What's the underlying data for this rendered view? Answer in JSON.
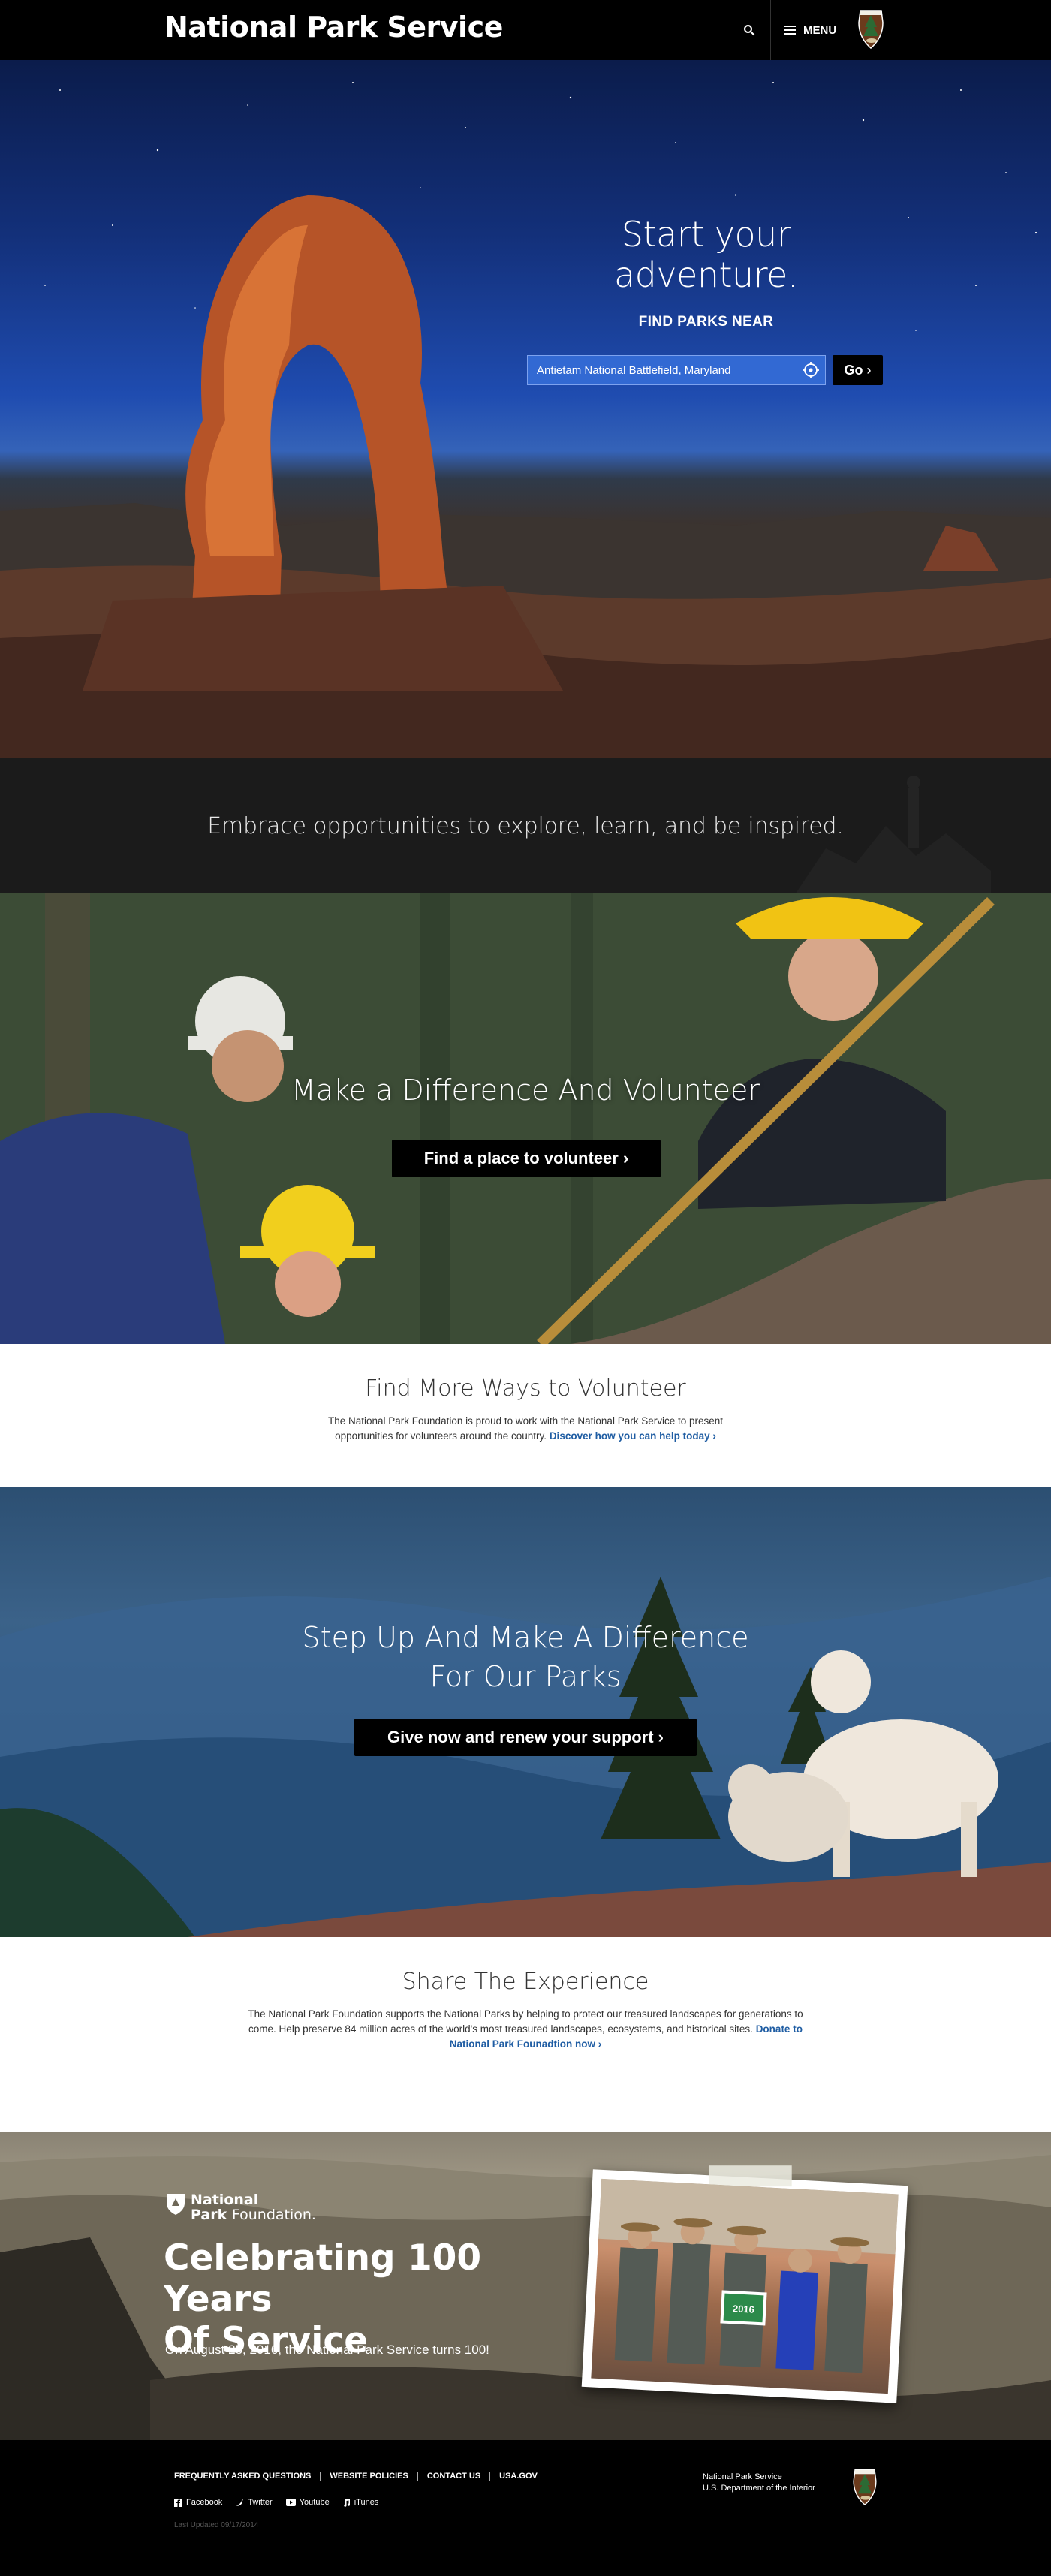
{
  "header": {
    "brand": "National Park Service",
    "search_icon": "search-icon",
    "menu_label": "MENU",
    "menu_icon": "hamburger-icon",
    "logo_icon": "nps-arrowhead-icon"
  },
  "hero": {
    "title": "Start your adventure.",
    "find_label": "FIND PARKS NEAR",
    "input_value": "Antietam National Battlefield, Maryland",
    "locate_icon": "crosshair-locate-icon",
    "go_label": "Go ›",
    "colors": {
      "input_bg": "#3269d3"
    }
  },
  "tagline": {
    "text": "Embrace opportunities to explore, learn, and be inspired."
  },
  "volunteer": {
    "title": "Make a Difference And Volunteer",
    "button": "Find a place to volunteer  ›"
  },
  "more_volunteer": {
    "title": "Find More Ways to Volunteer",
    "body": "The National Park Foundation is proud to work with the National Park Service to present opportunities for volunteers around the country.",
    "link": "Discover how you can help today ›"
  },
  "support": {
    "title_line1": "Step Up And Make A Difference",
    "title_line2": "For Our Parks",
    "button": "Give now and renew your support ›"
  },
  "share": {
    "title": "Share The Experience",
    "body": "The National Park Foundation supports the National Parks by helping to protect our treasured landscapes for generations to come. Help preserve 84 million acres of the world's most treasured landscapes, ecosystems, and historical sites.",
    "link": "Donate to National Park Founadtion now ›"
  },
  "centennial": {
    "foundation_line1": "National",
    "foundation_line2": "Park",
    "foundation_line2b": "Foundation.",
    "title_line1": "Celebrating 100 Years",
    "title_line2": "Of Service",
    "subtitle": "On August 25, 2016, the National Park Service turns 100!",
    "sign_text": "2016"
  },
  "footer": {
    "links": [
      "FREQUENTLY ASKED QUESTIONS",
      "WEBSITE POLICIES",
      "CONTACT US",
      "USA.GOV"
    ],
    "social": [
      "Facebook",
      "Twitter",
      "Youtube",
      "iTunes"
    ],
    "updated": "Last Updated 09/17/2014",
    "agency_line1": "National Park Service",
    "agency_line2": "U.S. Department of the Interior"
  }
}
